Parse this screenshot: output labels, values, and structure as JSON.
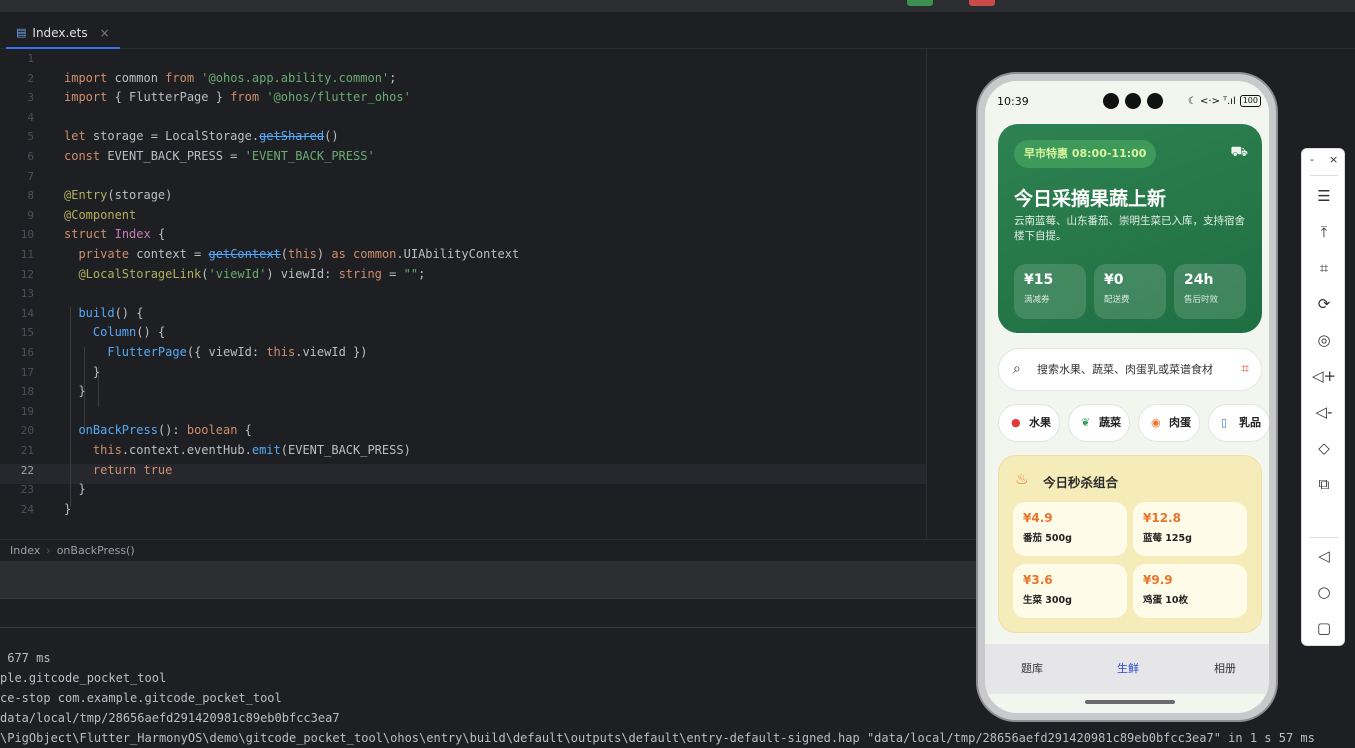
{
  "tab": {
    "filename": "Index.ets",
    "close": "×"
  },
  "editor": {
    "line_numbers": [
      "1",
      "2",
      "3",
      "4",
      "5",
      "6",
      "7",
      "8",
      "9",
      "10",
      "11",
      "12",
      "13",
      "14",
      "15",
      "16",
      "17",
      "18",
      "19",
      "20",
      "21",
      "22",
      "23",
      "24"
    ],
    "current_line": "22"
  },
  "breadcrumb": {
    "items": [
      "Index",
      "onBackPress()"
    ],
    "sep": "›"
  },
  "console": {
    "lines": [
      " 677 ms",
      "ple.gitcode_pocket_tool",
      "ce-stop com.example.gitcode_pocket_tool",
      "data/local/tmp/28656aefd291420981c89eb0bfcc3ea7",
      "\\PigObject\\Flutter_HarmonyOS\\demo\\gitcode_pocket_tool\\ohos\\entry\\build\\default\\outputs\\default\\entry-default-signed.hap \"data/local/tmp/28656aefd291420981c89eb0bfcc3ea7\" in 1 s 57 ms"
    ]
  },
  "phone": {
    "status": {
      "time": "10:39",
      "right": "☾ <·> ᵀ.ıl",
      "battery": "100"
    },
    "hero": {
      "badge": "早市特惠 08:00-11:00",
      "title": "今日采摘果蔬上新",
      "desc": "云南蓝莓、山东番茄、崇明生菜已入库，支持宿舍楼下自提。",
      "stats": [
        {
          "value": "¥15",
          "label": "满减券"
        },
        {
          "value": "¥0",
          "label": "配送费"
        },
        {
          "value": "24h",
          "label": "售后时效"
        }
      ]
    },
    "search": {
      "placeholder": "搜索水果、蔬菜、肉蛋乳或菜谱食材"
    },
    "chips": [
      {
        "label": "水果",
        "icon": "apple-icon"
      },
      {
        "label": "蔬菜",
        "icon": "leaf-icon"
      },
      {
        "label": "肉蛋",
        "icon": "egg-icon"
      },
      {
        "label": "乳品",
        "icon": "milk-icon"
      }
    ],
    "deal": {
      "title": "今日秒杀组合",
      "items": [
        {
          "price": "¥4.9",
          "name": "番茄 500g"
        },
        {
          "price": "¥12.8",
          "name": "蓝莓 125g"
        },
        {
          "price": "¥3.6",
          "name": "生菜 300g"
        },
        {
          "price": "¥9.9",
          "name": "鸡蛋 10枚"
        }
      ]
    },
    "nav": [
      {
        "label": "题库",
        "active": false
      },
      {
        "label": "生鲜",
        "active": true
      },
      {
        "label": "相册",
        "active": false
      }
    ]
  },
  "sidebar": {
    "top": [
      "-",
      "×"
    ],
    "tools": [
      "menu-icon",
      "screenshot-pin-icon",
      "crop-icon",
      "rotate-icon",
      "location-icon",
      "volume-up-icon",
      "volume-down-icon",
      "shake-icon",
      "fold-icon",
      "back-icon",
      "home-icon",
      "recents-icon"
    ]
  },
  "colors": {
    "accent": "#3574f0",
    "hero_green": "#2e8150",
    "deal_yellow": "#f6ecba",
    "price_orange": "#e9742a",
    "nav_active": "#2747c8"
  }
}
